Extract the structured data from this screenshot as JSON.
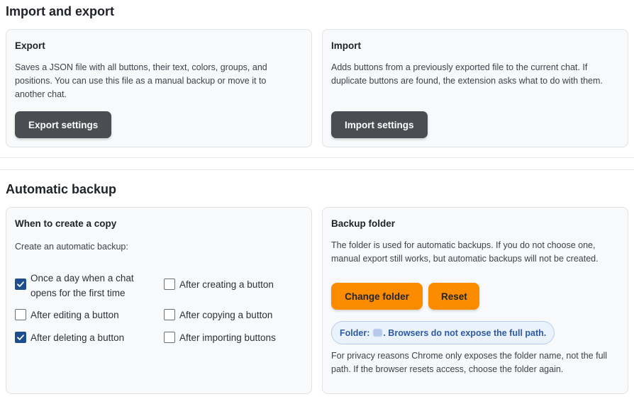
{
  "import_export": {
    "title": "Import and export",
    "export": {
      "title": "Export",
      "description": "Saves a JSON file with all buttons, their text, colors, groups, and positions. You can use this file as a manual backup or move it to another chat.",
      "button_label": "Export settings"
    },
    "import": {
      "title": "Import",
      "description": "Adds buttons from a previously exported file to the current chat. If duplicate buttons are found, the extension asks what to do with them.",
      "button_label": "Import settings"
    }
  },
  "automatic_backup": {
    "title": "Automatic backup",
    "when": {
      "title": "When to create a copy",
      "label": "Create an automatic backup:",
      "options": [
        {
          "label": "Once a day when a chat opens for the first time",
          "checked": true
        },
        {
          "label": "After creating a button",
          "checked": false
        },
        {
          "label": "After editing a button",
          "checked": false
        },
        {
          "label": "After copying a button",
          "checked": false
        },
        {
          "label": "After deleting a button",
          "checked": true
        },
        {
          "label": "After importing buttons",
          "checked": false
        }
      ]
    },
    "folder": {
      "title": "Backup folder",
      "description": "The folder is used for automatic backups. If you do not choose one, manual export still works, but automatic backups will not be created.",
      "change_label": "Change folder",
      "reset_label": "Reset",
      "pill_prefix": "Folder:",
      "pill_suffix": ". Browsers do not expose the full path.",
      "privacy_note": "For privacy reasons Chrome only exposes the folder name, not the full path. If the browser resets access, choose the folder again."
    }
  },
  "colors": {
    "dark_button": "#4a4e53",
    "orange_button": "#fb8c00",
    "checkbox_checked": "#1f4e8f",
    "pill_text": "#2d5aa3"
  }
}
